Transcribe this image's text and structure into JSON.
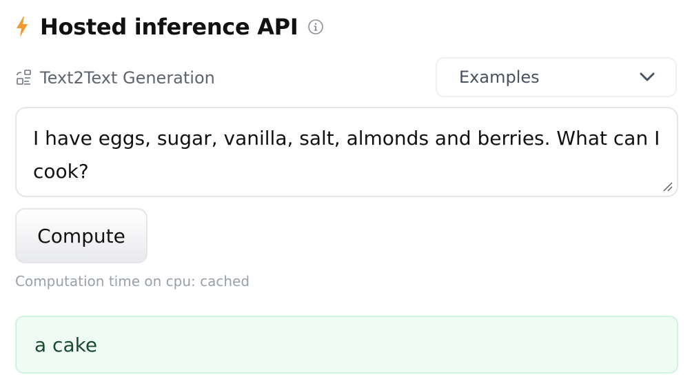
{
  "widget": {
    "title": "Hosted inference API",
    "task_label": "Text2Text Generation",
    "examples_label": "Examples",
    "input_text": "I have eggs, sugar, vanilla, salt, almonds and berries. What can I\ncook?",
    "compute_label": "Compute",
    "computation_time": "Computation time on cpu: cached",
    "output_text": "a cake"
  },
  "icons": {
    "header": "lightning-bolt-icon",
    "info": "info-circle-icon",
    "task": "text2text-generation-icon",
    "dropdown": "chevron-down-icon",
    "resize": "resize-handle-icon"
  },
  "colors": {
    "bolt": "#F29A2E",
    "output_bg": "#EFFCF3",
    "output_border": "#D3F2DD",
    "output_text": "#1A4A2D"
  }
}
